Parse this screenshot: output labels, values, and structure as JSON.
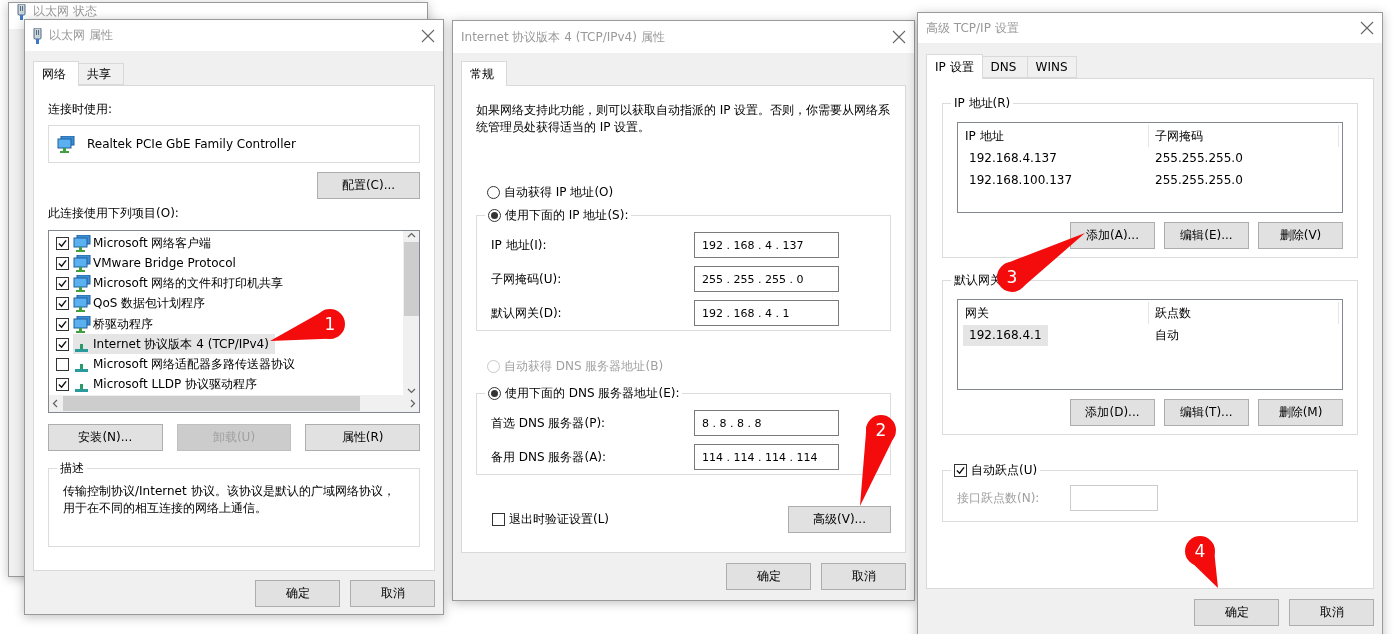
{
  "status_window": {
    "title": "以太网 状态"
  },
  "ethernet": {
    "title": "以太网 属性",
    "tabs": [
      {
        "label": "网络",
        "selected": true
      },
      {
        "label": "共享",
        "selected": false
      }
    ],
    "connect_label": "连接时使用:",
    "adapter": "Realtek PCIe GbE Family Controller",
    "configure_button": "配置(C)...",
    "items_label": "此连接使用下列项目(O):",
    "items": [
      {
        "kind": "client",
        "label": "Microsoft 网络客户端",
        "checked": true,
        "selected": false
      },
      {
        "kind": "client",
        "label": "VMware Bridge Protocol",
        "checked": true,
        "selected": false
      },
      {
        "kind": "client",
        "label": "Microsoft 网络的文件和打印机共享",
        "checked": true,
        "selected": false
      },
      {
        "kind": "client",
        "label": "QoS 数据包计划程序",
        "checked": true,
        "selected": false
      },
      {
        "kind": "client",
        "label": "桥驱动程序",
        "checked": true,
        "selected": false
      },
      {
        "kind": "protocol",
        "label": "Internet 协议版本 4 (TCP/IPv4)",
        "checked": true,
        "selected": true
      },
      {
        "kind": "protocol",
        "label": "Microsoft 网络适配器多路传送器协议",
        "checked": false,
        "selected": false
      },
      {
        "kind": "protocol",
        "label": "Microsoft LLDP 协议驱动程序",
        "checked": true,
        "selected": false
      }
    ],
    "buttons": [
      {
        "label": "安装(N)...",
        "disabled": false
      },
      {
        "label": "卸载(U)",
        "disabled": true
      },
      {
        "label": "属性(R)",
        "disabled": false
      }
    ],
    "description": {
      "label": "描述",
      "text": "传输控制协议/Internet 协议。该协议是默认的广域网络协议，用于在不同的相互连接的网络上通信。"
    },
    "footer": [
      "确定",
      "取消"
    ]
  },
  "ipv4": {
    "title": "Internet 协议版本 4 (TCP/IPv4) 属性",
    "tabs": [
      {
        "label": "常规",
        "selected": true
      }
    ],
    "intro": "如果网络支持此功能，则可以获取自动指派的 IP 设置。否则，你需要从网络系统管理员处获得适当的 IP 设置。",
    "ip_options": [
      {
        "label": "自动获得 IP 地址(O)",
        "selected": false,
        "disabled": false
      },
      {
        "label": "使用下面的 IP 地址(S):",
        "selected": true,
        "disabled": false
      }
    ],
    "ip_fields": [
      {
        "label": "IP 地址(I):",
        "value": "192 . 168 . 4 . 137"
      },
      {
        "label": "子网掩码(U):",
        "value": "255 . 255 . 255 . 0"
      },
      {
        "label": "默认网关(D):",
        "value": "192 . 168 . 4 . 1"
      }
    ],
    "dns_options": [
      {
        "label": "自动获得 DNS 服务器地址(B)",
        "selected": false,
        "disabled": true
      },
      {
        "label": "使用下面的 DNS 服务器地址(E):",
        "selected": true,
        "disabled": false
      }
    ],
    "dns_fields": [
      {
        "label": "首选 DNS 服务器(P):",
        "value": "8 . 8 . 8 . 8"
      },
      {
        "label": "备用 DNS 服务器(A):",
        "value": "114 . 114 . 114 . 114"
      }
    ],
    "validate": {
      "label": "退出时验证设置(L)",
      "checked": false
    },
    "advanced_button": "高级(V)...",
    "footer": [
      "确定",
      "取消"
    ]
  },
  "advanced": {
    "title": "高级 TCP/IP 设置",
    "tabs": [
      {
        "label": "IP 设置",
        "selected": true
      },
      {
        "label": "DNS",
        "selected": false
      },
      {
        "label": "WINS",
        "selected": false
      }
    ],
    "ip_group": {
      "label": "IP 地址(R)",
      "columns": [
        "IP 地址",
        "子网掩码"
      ],
      "rows": [
        {
          "cells": [
            "192.168.4.137",
            "255.255.255.0"
          ],
          "selected": false
        },
        {
          "cells": [
            "192.168.100.137",
            "255.255.255.0"
          ],
          "selected": false
        }
      ],
      "buttons": [
        "添加(A)...",
        "编辑(E)...",
        "删除(V)"
      ]
    },
    "gateway_group": {
      "label": "默认网关",
      "columns": [
        "网关",
        "跃点数"
      ],
      "rows": [
        {
          "cells": [
            "192.168.4.1",
            "自动"
          ],
          "selected": true
        }
      ],
      "buttons": [
        "添加(D)...",
        "编辑(T)...",
        "删除(M)"
      ]
    },
    "auto_metric": {
      "label": "自动跃点(U)",
      "checked": true
    },
    "metric_field": {
      "label": "接口跃点数(N):",
      "disabled": true
    },
    "footer": [
      "确定",
      "取消"
    ]
  },
  "markers": [
    {
      "number": "1"
    },
    {
      "number": "2"
    },
    {
      "number": "3"
    },
    {
      "number": "4"
    }
  ]
}
